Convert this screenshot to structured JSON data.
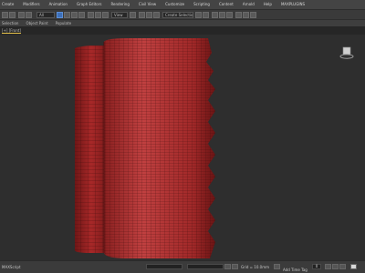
{
  "menubar": {
    "items": [
      "Create",
      "Modifiers",
      "Animation",
      "Graph Editors",
      "Rendering",
      "Civil View",
      "Customize",
      "Scripting",
      "Content",
      "Arnold",
      "Help",
      "MAXPLUGINS"
    ]
  },
  "toolbar": {
    "selection_filter": "All",
    "view_dropdown": "View",
    "named_selection_placeholder": "Create Selection Set"
  },
  "ribbon": {
    "tabs": [
      "Selection",
      "Object Paint",
      "Populate"
    ]
  },
  "viewport": {
    "label": "[+] [Front]",
    "model_color": "#a82828",
    "wire_color": "#3a0c0c",
    "background": "#2e2e2e"
  },
  "statusbar": {
    "left_label": "MAXScript",
    "grid_label": "Grid = 10.0mm",
    "time_tag": "Add Time Tag",
    "frame_value": "0",
    "key_mode": "Auto"
  }
}
